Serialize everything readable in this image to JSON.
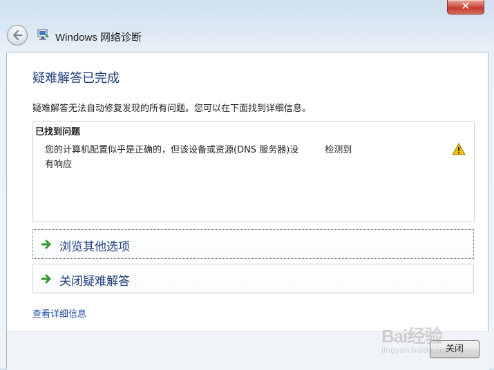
{
  "window": {
    "title": "Windows 网络诊断",
    "close_glyph": "✕",
    "title_icon": "network-diagnostics-icon",
    "back_icon": "back-arrow-icon"
  },
  "main": {
    "heading": "疑难解答已完成",
    "description": "疑难解答无法自动修复发现的所有问题。您可以在下面找到详细信息。",
    "problems_panel": {
      "title": "已找到问题",
      "items": [
        {
          "text": "您的计算机配置似乎是正确的，但该设备或资源(DNS 服务器)没",
          "status": "检测到",
          "text_cont": "有响应",
          "status_icon": "warning-icon"
        }
      ]
    },
    "options": [
      {
        "label": "浏览其他选项",
        "icon": "green-arrow-icon"
      },
      {
        "label": "关闭疑难解答",
        "icon": "green-arrow-icon"
      }
    ],
    "detail_link": "查看详细信息"
  },
  "footer": {
    "close_button": "关闭"
  },
  "watermark": {
    "text": "Bai经验",
    "sub": "jingyan.baidu.com"
  },
  "colors": {
    "heading": "#1e3c7c",
    "link": "#1e4ba0",
    "arrow_green": "#2c9a2c",
    "warning": "#f2c200"
  }
}
